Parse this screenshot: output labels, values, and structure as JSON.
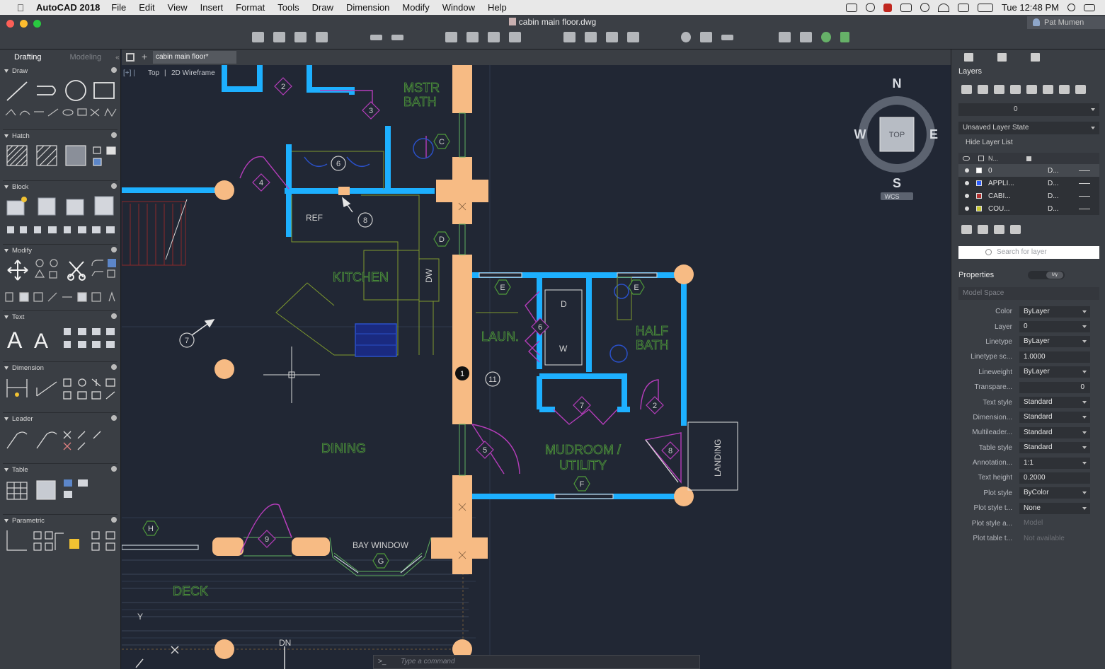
{
  "menubar": {
    "app_name": "AutoCAD 2018",
    "items": [
      "File",
      "Edit",
      "View",
      "Insert",
      "Format",
      "Tools",
      "Draw",
      "Dimension",
      "Modify",
      "Window",
      "Help"
    ],
    "clock": "Tue 12:48 PM"
  },
  "window": {
    "doc_title": "cabin main floor.dwg",
    "user": "Pat Mumen"
  },
  "palette": {
    "tabs": [
      "Drafting",
      "Modeling"
    ],
    "sections": [
      "Draw",
      "Hatch",
      "Block",
      "Modify",
      "Text",
      "Dimension",
      "Leader",
      "Table",
      "Parametric"
    ]
  },
  "canvas": {
    "file_tab": "cabin main floor*",
    "view_top": "Top",
    "view_style": "2D Wireframe",
    "viewcube": {
      "top": "TOP",
      "n": "N",
      "s": "S",
      "e": "E",
      "w": "W",
      "wcs": "WCS"
    },
    "rooms": {
      "mstr1": "MSTR",
      "mstr2": "BATH",
      "ref": "REF",
      "kitchen": "KITCHEN",
      "dw": "DW",
      "laun": "LAUN.",
      "half1": "HALF",
      "half2": "BATH",
      "dining": "DINING",
      "mud1": "MUDROOM /",
      "mud2": "UTILITY",
      "landing": "LANDING",
      "bay": "BAY WINDOW",
      "deck": "DECK",
      "dn": "DN",
      "d": "D",
      "w": "W",
      "y": "Y"
    },
    "tags": {
      "n2": "2",
      "n3": "3",
      "n4": "4",
      "n5": "5",
      "n6": "6",
      "n6b": "6",
      "n7": "7",
      "n7b": "7",
      "n2b": "2",
      "n8": "8",
      "n8b": "8",
      "n9": "9",
      "n1": "1",
      "n11": "11",
      "c": "C",
      "dd": "D",
      "e1": "E",
      "e2": "E",
      "f": "F",
      "g": "G",
      "h": "H"
    },
    "command_prompt": ">_",
    "command_placeholder": "Type a command"
  },
  "layers": {
    "title": "Layers",
    "current": "0",
    "layer_state": "Unsaved Layer State",
    "hide_list": "Hide Layer List",
    "header": "N...",
    "rows": [
      {
        "name": "0",
        "desc": "D...",
        "color": "#ffffff"
      },
      {
        "name": "APPLI...",
        "desc": "D...",
        "color": "#2b5cff"
      },
      {
        "name": "CABI...",
        "desc": "D...",
        "color": "#b03030"
      },
      {
        "name": "COU...",
        "desc": "D...",
        "color": "#c9c930"
      }
    ],
    "search_placeholder": "Search for layer"
  },
  "properties": {
    "title": "Properties",
    "toggle": "My",
    "space": "Model Space",
    "rows": [
      {
        "label": "Color",
        "value": "ByLayer",
        "style": "dd"
      },
      {
        "label": "Layer",
        "value": "0",
        "style": "dd"
      },
      {
        "label": "Linetype",
        "value": "ByLayer",
        "style": "dd"
      },
      {
        "label": "Linetype sc...",
        "value": "1.0000",
        "style": ""
      },
      {
        "label": "Lineweight",
        "value": "ByLayer",
        "style": "dd"
      },
      {
        "label": "Transpare...",
        "value": "0",
        "style": ""
      },
      {
        "label": "Text style",
        "value": "Standard",
        "style": "dd"
      },
      {
        "label": "Dimension...",
        "value": "Standard",
        "style": "dd"
      },
      {
        "label": "Multileader...",
        "value": "Standard",
        "style": "dd"
      },
      {
        "label": "Table style",
        "value": "Standard",
        "style": "dd"
      },
      {
        "label": "Annotation...",
        "value": "1:1",
        "style": "dd"
      },
      {
        "label": "Text height",
        "value": "0.2000",
        "style": ""
      },
      {
        "label": "Plot style",
        "value": "ByColor",
        "style": "dd"
      },
      {
        "label": "Plot style t...",
        "value": "None",
        "style": "dd"
      },
      {
        "label": "Plot style a...",
        "value": "Model",
        "style": "dim"
      },
      {
        "label": "Plot table t...",
        "value": "Not available",
        "style": "dim"
      }
    ]
  }
}
